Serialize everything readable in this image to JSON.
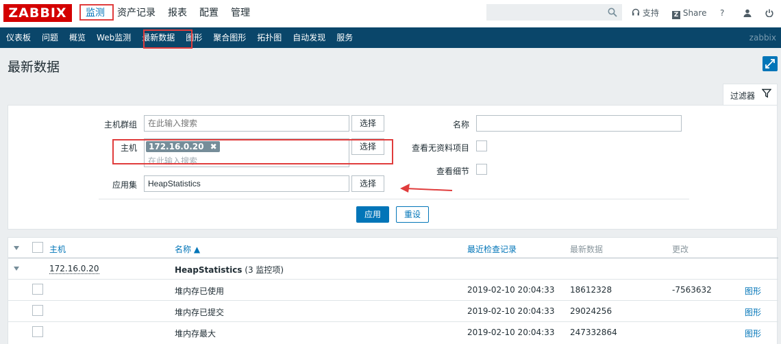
{
  "brand": {
    "logo": "ZABBIX"
  },
  "main_menu": [
    "监测",
    "资产记录",
    "报表",
    "配置",
    "管理"
  ],
  "top_links": {
    "support": "支持",
    "share": "Share",
    "help": "?"
  },
  "sub_menu": [
    "仪表板",
    "问题",
    "概览",
    "Web监测",
    "最新数据",
    "图形",
    "聚合图形",
    "拓扑图",
    "自动发现",
    "服务"
  ],
  "sub_brand": "zabbix",
  "page_title": "最新数据",
  "filter": {
    "tab_label": "过滤器",
    "host_group_label": "主机群组",
    "host_group_placeholder": "在此输入搜索",
    "host_label": "主机",
    "host_tag": "172.16.0.20",
    "host_placeholder": "在此输入搜索",
    "app_label": "应用集",
    "app_value": "HeapStatistics",
    "select_label": "选择",
    "name_label": "名称",
    "show_no_data_label": "查看无资料项目",
    "show_details_label": "查看细节",
    "apply_label": "应用",
    "reset_label": "重设"
  },
  "table": {
    "headers": {
      "host": "主机",
      "name": "名称 ▲",
      "last_check": "最近检查记录",
      "last_value": "最新数据",
      "change": "更改"
    },
    "group": {
      "host": "172.16.0.20",
      "app": "HeapStatistics",
      "count": "(3 监控项)"
    },
    "rows": [
      {
        "name": "堆内存已使用",
        "time": "2019-02-10 20:04:33",
        "value": "18612328",
        "change": "-7563632",
        "graph": "图形"
      },
      {
        "name": "堆内存已提交",
        "time": "2019-02-10 20:04:33",
        "value": "29024256",
        "change": "",
        "graph": "图形"
      },
      {
        "name": "堆内存最大",
        "time": "2019-02-10 20:04:33",
        "value": "247332864",
        "change": "",
        "graph": "图形"
      }
    ]
  },
  "colors": {
    "accent": "#0275b8",
    "nav": "#0a466a",
    "highlight": "#e03c3c",
    "brand": "#d40000"
  }
}
